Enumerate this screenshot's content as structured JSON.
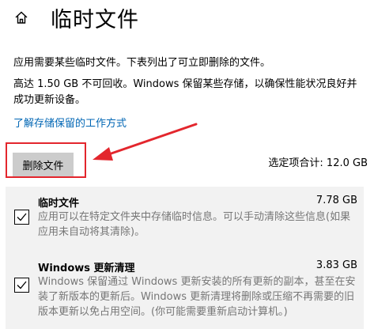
{
  "header": {
    "icon": "home-icon",
    "title": "临时文件"
  },
  "description": {
    "line1": "应用需要某些临时文件。下表列出了可立即删除的文件。",
    "line2": "高达 1.50 GB 不可回收。Windows 保留某些存储，以确保性能状况良好并成功更新设备。"
  },
  "learn_link": "了解存储保留的工作方式",
  "actions": {
    "delete_label": "删除文件",
    "selected_total": "选定项合计: 12.0 GB"
  },
  "items": [
    {
      "name": "临时文件",
      "size": "7.78 GB",
      "checked": true,
      "description": "应用可以在特定文件夹中存储临时信息。可以手动清除这些信息(如果应用未自动将其清除)。"
    },
    {
      "name": "Windows 更新清理",
      "size": "3.83 GB",
      "checked": true,
      "description": "Windows 保留通过 Windows 更新安装的所有更新的副本，甚至在安装了新版本的更新后。Windows 更新清理将删除或压缩不再需要的旧版本更新以免占用空间。(你可能需要重新启动计算机。)"
    }
  ],
  "colors": {
    "accent_link": "#0066b4",
    "annotation_red": "#e3262d",
    "button_bg": "#cccccc",
    "list_bg": "#f2f2f2",
    "secondary_text": "#767676"
  }
}
